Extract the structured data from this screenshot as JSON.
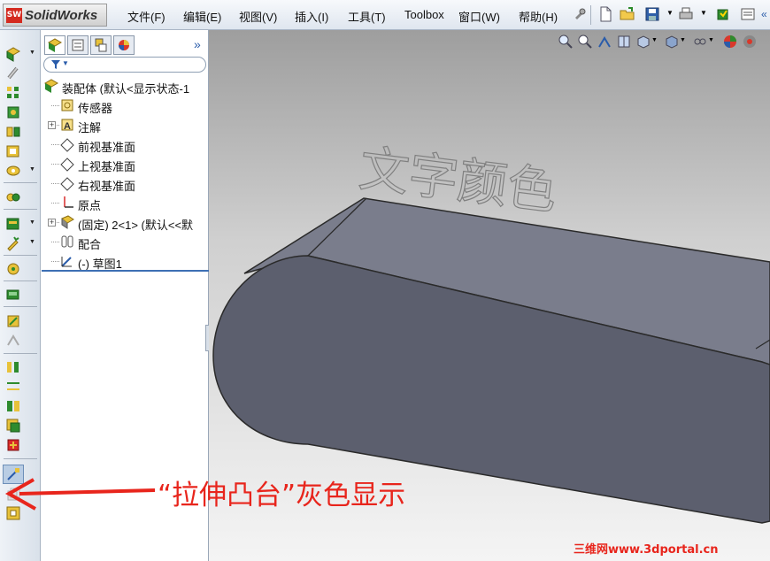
{
  "app": {
    "logo_text": "SolidWorks",
    "logo_mark": "SW"
  },
  "menu": [
    "文件(F)",
    "编辑(E)",
    "视图(V)",
    "插入(I)",
    "工具(T)",
    "Toolbox",
    "窗口(W)",
    "帮助(H)"
  ],
  "toolbar_icons": [
    "pin-icon",
    "new-document-icon",
    "open-folder-icon",
    "save-icon",
    "print-icon",
    "rebuild-icon",
    "options-icon"
  ],
  "left_toolbar_icons": [
    "insert-component-icon",
    "mate-icon",
    "linear-pattern-icon",
    "smart-fasteners-icon",
    "move-component-icon",
    "show-hidden-icon",
    "assembly-features-icon",
    "reference-geometry-icon",
    "new-motion-study-icon",
    "bill-of-materials-icon",
    "exploded-view-icon",
    "explode-line-sketch-icon",
    "interference-detection-icon",
    "clearance-verification-icon",
    "hole-alignment-icon",
    "measure-icon",
    "mass-properties-icon",
    "assembly-visualization-icon",
    "performance-evaluation-icon",
    "sketch-icon",
    "extruded-boss-icon",
    "instant3d-icon"
  ],
  "panel_tabs": [
    "feature-manager-icon",
    "property-manager-icon",
    "configuration-manager-icon",
    "display-manager-icon"
  ],
  "panel_expand": "»",
  "tree": [
    {
      "label": "装配体  (默认<显示状态-1",
      "icon": "assembly-icon",
      "level": 0,
      "expander": ""
    },
    {
      "label": "传感器",
      "icon": "sensor-icon",
      "level": 1,
      "expander": ""
    },
    {
      "label": "注解",
      "icon": "annotation-icon",
      "level": 1,
      "expander": "+"
    },
    {
      "label": "前视基准面",
      "icon": "plane-icon",
      "level": 1,
      "expander": ""
    },
    {
      "label": "上视基准面",
      "icon": "plane-icon",
      "level": 1,
      "expander": ""
    },
    {
      "label": "右视基准面",
      "icon": "plane-icon",
      "level": 1,
      "expander": ""
    },
    {
      "label": "原点",
      "icon": "origin-icon",
      "level": 1,
      "expander": ""
    },
    {
      "label": "(固定) 2<1> (默认<<默",
      "icon": "part-icon",
      "level": 1,
      "expander": "+"
    },
    {
      "label": "配合",
      "icon": "mates-icon",
      "level": 1,
      "expander": ""
    },
    {
      "label": "(-) 草图1",
      "icon": "sketch-icon",
      "level": 1,
      "expander": ""
    }
  ],
  "view_tools": [
    "zoom-to-fit-icon",
    "zoom-area-icon",
    "previous-view-icon",
    "section-view-icon",
    "view-orientation-icon",
    "display-style-icon",
    "hide-show-icon",
    "edit-appearance-icon",
    "apply-scene-icon"
  ],
  "model": {
    "engraved_text": "文字颜色",
    "body_color": "#5c5f6e",
    "top_color": "#7a7d8c"
  },
  "annotation": {
    "text": "“拉伸凸台”灰色显示",
    "color": "#e8251c"
  },
  "watermark": "三维网www.3dportal.cn"
}
